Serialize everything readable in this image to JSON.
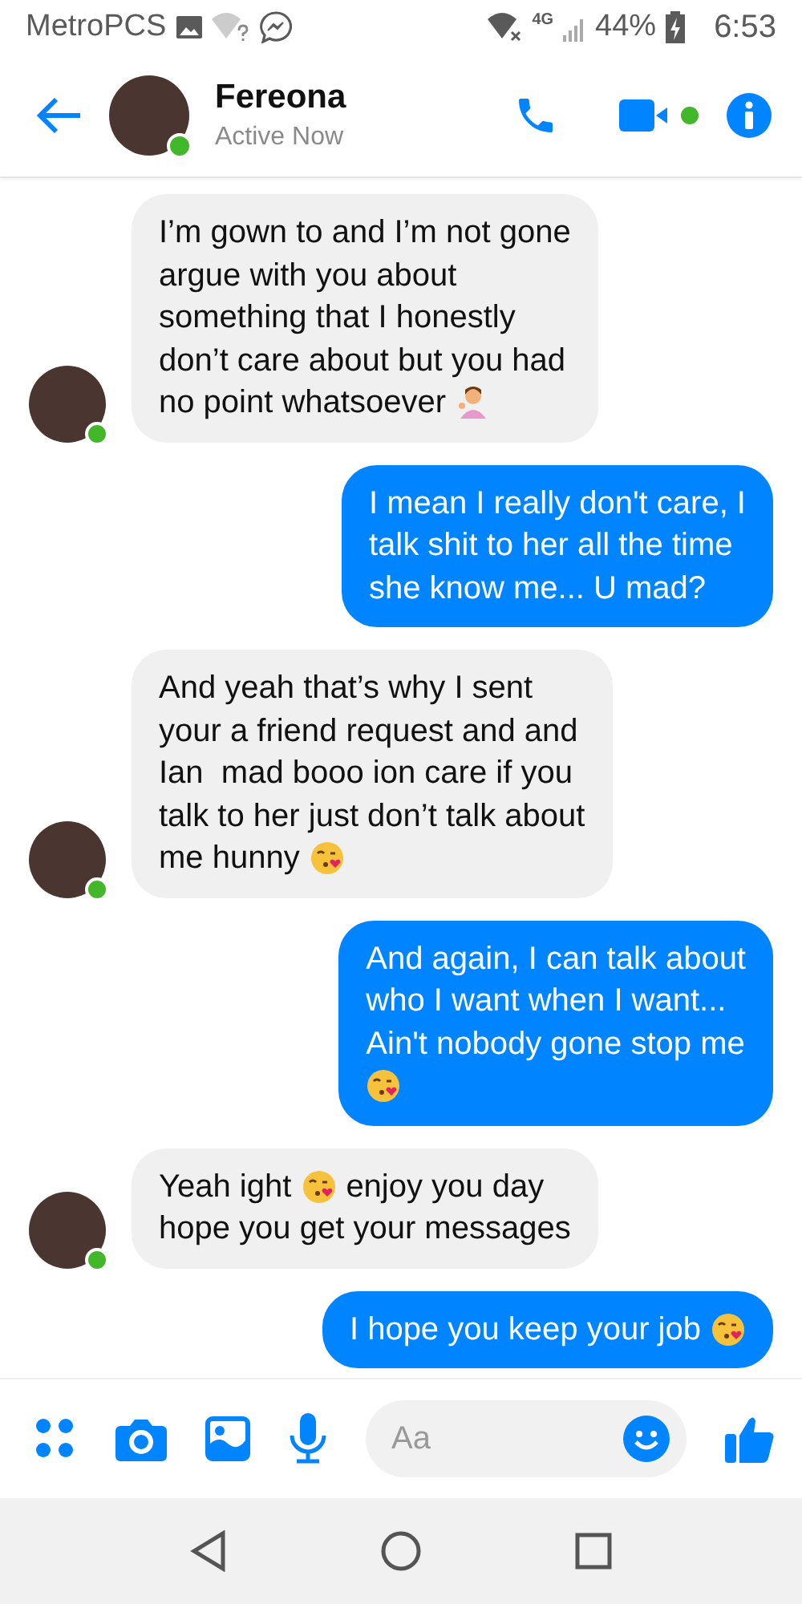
{
  "status_bar": {
    "carrier": "MetroPCS",
    "network": "4G",
    "battery": "44%",
    "time": "6:53"
  },
  "header": {
    "name": "Fereona",
    "status": "Active Now",
    "online": true
  },
  "messages": [
    {
      "kind": "incoming",
      "lines": [
        [
          {
            "kind": "text",
            "text": "I’m gown to and I’m not gone"
          }
        ],
        [
          {
            "kind": "text",
            "text": "argue with you about"
          }
        ],
        [
          {
            "kind": "text",
            "text": "something that I honestly"
          }
        ],
        [
          {
            "kind": "text",
            "text": "don’t care about but you had"
          }
        ],
        [
          {
            "kind": "text",
            "text": "no point whatsoever"
          },
          {
            "kind": "gesture"
          }
        ]
      ]
    },
    {
      "kind": "outgoing",
      "lines": [
        [
          {
            "kind": "text",
            "text": "I mean I really don't care, I"
          }
        ],
        [
          {
            "kind": "text",
            "text": "talk shit to her all the time"
          }
        ],
        [
          {
            "kind": "text",
            "text": "she know me... U mad?"
          }
        ]
      ]
    },
    {
      "kind": "incoming",
      "lines": [
        [
          {
            "kind": "text",
            "text": "And yeah that’s why I sent"
          }
        ],
        [
          {
            "kind": "text",
            "text": "your a friend request and and"
          }
        ],
        [
          {
            "kind": "text",
            "text": "Ian  mad booo ion care if you"
          }
        ],
        [
          {
            "kind": "text",
            "text": "talk to her just don’t talk about"
          }
        ],
        [
          {
            "kind": "text",
            "text": "me hunny"
          },
          {
            "kind": "kiss"
          }
        ]
      ]
    },
    {
      "kind": "outgoing",
      "lines": [
        [
          {
            "kind": "text",
            "text": "And again, I can talk about"
          }
        ],
        [
          {
            "kind": "text",
            "text": "who I want when I want..."
          }
        ],
        [
          {
            "kind": "text",
            "text": "Ain't nobody gone stop me"
          }
        ],
        [
          {
            "kind": "kiss"
          }
        ]
      ]
    },
    {
      "kind": "incoming",
      "lines": [
        [
          {
            "kind": "text",
            "text": "Yeah ight"
          },
          {
            "kind": "kiss"
          },
          {
            "kind": "text",
            "text": "enjoy you day"
          }
        ],
        [
          {
            "kind": "text",
            "text": "hope you get your messages"
          }
        ]
      ]
    },
    {
      "kind": "outgoing",
      "lines": [
        [
          {
            "kind": "text",
            "text": "I hope you keep your job"
          },
          {
            "kind": "kiss"
          }
        ]
      ]
    }
  ],
  "composer": {
    "placeholder": "Aa"
  }
}
